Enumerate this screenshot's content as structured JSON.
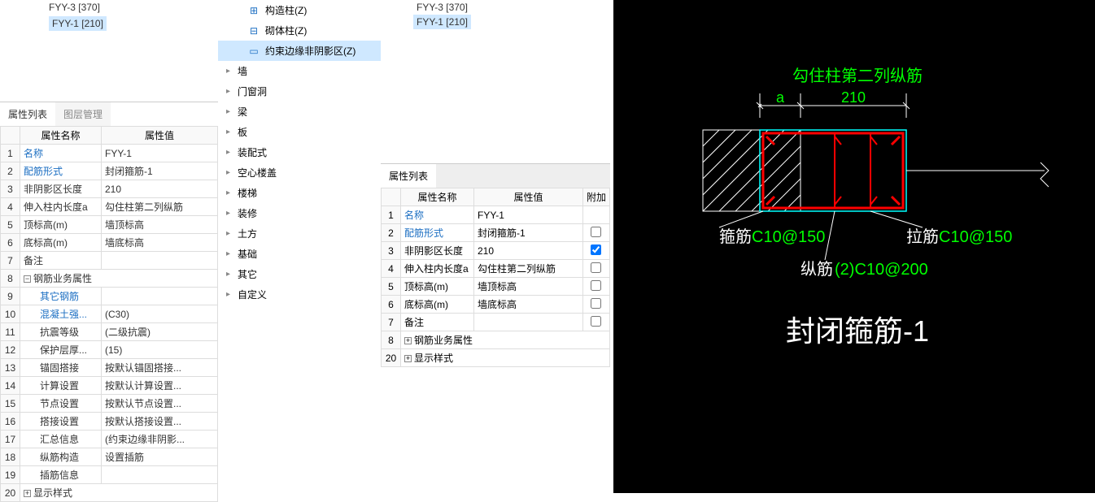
{
  "panel1": {
    "tree": [
      {
        "label": "FYY-3 [370]",
        "selected": false
      },
      {
        "label": "FYY-1 [210]",
        "selected": true
      }
    ],
    "tabs": [
      {
        "label": "属性列表",
        "active": true
      },
      {
        "label": "图层管理",
        "active": false
      }
    ],
    "headers": {
      "name": "属性名称",
      "value": "属性值"
    },
    "rows": [
      {
        "n": "1",
        "name": "名称",
        "val": "FYY-1",
        "link": true
      },
      {
        "n": "2",
        "name": "配筋形式",
        "val": "封闭箍筋-1",
        "link": true
      },
      {
        "n": "3",
        "name": "非阴影区长度",
        "val": "210"
      },
      {
        "n": "4",
        "name": "伸入柱内长度a",
        "val": "勾住柱第二列纵筋"
      },
      {
        "n": "5",
        "name": "顶标高(m)",
        "val": "墙顶标高"
      },
      {
        "n": "6",
        "name": "底标高(m)",
        "val": "墙底标高"
      },
      {
        "n": "7",
        "name": "备注",
        "val": ""
      },
      {
        "n": "8",
        "name": "钢筋业务属性",
        "val": "",
        "group": true,
        "exp": "−"
      },
      {
        "n": "9",
        "name": "其它钢筋",
        "val": "",
        "link": true,
        "indent": 2
      },
      {
        "n": "10",
        "name": "混凝土强...",
        "val": "(C30)",
        "link": true,
        "indent": 2
      },
      {
        "n": "11",
        "name": "抗震等级",
        "val": "(二级抗震)",
        "indent": 2
      },
      {
        "n": "12",
        "name": "保护层厚...",
        "val": "(15)",
        "indent": 2
      },
      {
        "n": "13",
        "name": "锚固搭接",
        "val": "按默认锚固搭接...",
        "indent": 2
      },
      {
        "n": "14",
        "name": "计算设置",
        "val": "按默认计算设置...",
        "indent": 2
      },
      {
        "n": "15",
        "name": "节点设置",
        "val": "按默认节点设置...",
        "indent": 2
      },
      {
        "n": "16",
        "name": "搭接设置",
        "val": "按默认搭接设置...",
        "indent": 2
      },
      {
        "n": "17",
        "name": "汇总信息",
        "val": "(约束边缘非阴影...",
        "indent": 2
      },
      {
        "n": "18",
        "name": "纵筋构造",
        "val": "设置插筋",
        "indent": 2
      },
      {
        "n": "19",
        "name": "插筋信息",
        "val": "",
        "indent": 2
      },
      {
        "n": "20",
        "name": "显示样式",
        "val": "",
        "group": true,
        "exp": "+"
      }
    ]
  },
  "panel2": {
    "items": [
      {
        "label": "构造柱(Z)",
        "icon": "col-icon",
        "lvl": 2,
        "hot": "(Z)"
      },
      {
        "label": "砌体柱(Z)",
        "icon": "brick-icon",
        "lvl": 2
      },
      {
        "label": "约束边缘非阴影区(Z)",
        "icon": "rect-icon",
        "lvl": 2,
        "selected": true
      },
      {
        "label": "墙",
        "lvl": 1,
        "arrow": true
      },
      {
        "label": "门窗洞",
        "lvl": 1,
        "arrow": true
      },
      {
        "label": "梁",
        "lvl": 1,
        "arrow": true
      },
      {
        "label": "板",
        "lvl": 1,
        "arrow": true
      },
      {
        "label": "装配式",
        "lvl": 1,
        "arrow": true
      },
      {
        "label": "空心楼盖",
        "lvl": 1,
        "arrow": true
      },
      {
        "label": "楼梯",
        "lvl": 1,
        "arrow": true
      },
      {
        "label": "装修",
        "lvl": 1,
        "arrow": true
      },
      {
        "label": "土方",
        "lvl": 1,
        "arrow": true
      },
      {
        "label": "基础",
        "lvl": 1,
        "arrow": true
      },
      {
        "label": "其它",
        "lvl": 1,
        "arrow": true
      },
      {
        "label": "自定义",
        "lvl": 1,
        "arrow": true
      }
    ]
  },
  "panel3": {
    "tree": [
      {
        "label": "FYY-3 [370]",
        "selected": false
      },
      {
        "label": "FYY-1 [210]",
        "selected": true
      }
    ],
    "tab": "属性列表",
    "headers": {
      "name": "属性名称",
      "value": "属性值",
      "extra": "附加"
    },
    "rows": [
      {
        "n": "1",
        "name": "名称",
        "val": "FYY-1",
        "link": true,
        "chk": null
      },
      {
        "n": "2",
        "name": "配筋形式",
        "val": "封闭箍筋-1",
        "link": true,
        "chk": false
      },
      {
        "n": "3",
        "name": "非阴影区长度",
        "val": "210",
        "chk": true
      },
      {
        "n": "4",
        "name": "伸入柱内长度a",
        "val": "勾住柱第二列纵筋",
        "chk": false
      },
      {
        "n": "5",
        "name": "顶标高(m)",
        "val": "墙顶标高",
        "chk": false
      },
      {
        "n": "6",
        "name": "底标高(m)",
        "val": "墙底标高",
        "chk": false
      },
      {
        "n": "7",
        "name": "备注",
        "val": "",
        "chk": false
      },
      {
        "n": "8",
        "name": "钢筋业务属性",
        "val": "",
        "group": true,
        "exp": "+"
      },
      {
        "n": "20",
        "name": "显示样式",
        "val": "",
        "group": true,
        "exp": "+"
      }
    ]
  },
  "cad": {
    "topText": "勾住柱第二列纵筋",
    "dimA": "a",
    "dim210": "210",
    "labels": {
      "gujin": "箍筋",
      "gujin_val": "C10@150",
      "lajin": "拉筋",
      "lajin_val": "C10@150",
      "zongjin": "纵筋",
      "zongjin_val": "(2)C10@200"
    },
    "title": "封闭箍筋-1"
  }
}
